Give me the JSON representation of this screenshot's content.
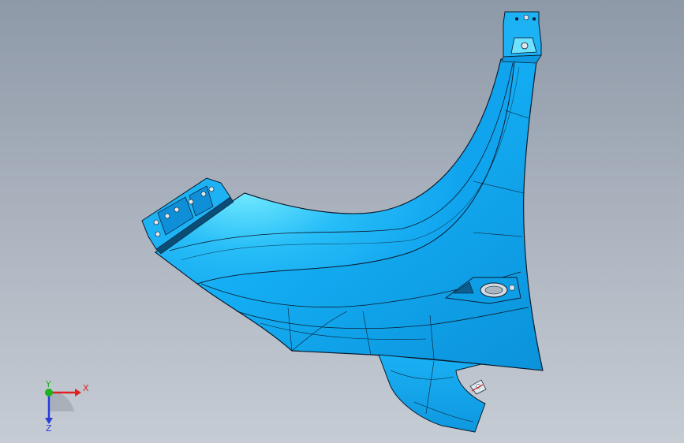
{
  "viewport": {
    "background_top": "#8e99a8",
    "background_bottom": "#c6ccd4"
  },
  "model": {
    "part_color": "#12aaf2",
    "highlight_color": "#5ee3ff",
    "shadow_color": "#0a8fd6",
    "edge_color": "#0b1a2c"
  },
  "triad": {
    "x_label": "X",
    "y_label": "Y",
    "z_label": "Z",
    "x_color": "#e02020",
    "y_color": "#1fb21f",
    "z_color": "#2b3bd8"
  }
}
